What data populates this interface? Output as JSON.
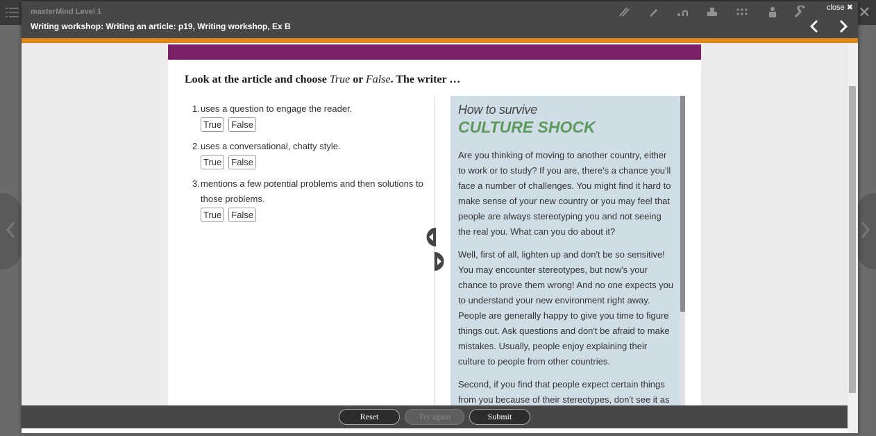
{
  "app": {
    "title": "masterMind Level 1"
  },
  "header": {
    "page_title": "Writing workshop: Writing an article: p19, Writing workshop, Ex B",
    "close_label": "close ✖"
  },
  "exercise": {
    "instruction_pre": "Look at the article and choose ",
    "instruction_true": "True",
    "instruction_mid": " or ",
    "instruction_false": "False",
    "instruction_post": ". The writer …",
    "questions": [
      {
        "number": "1.",
        "text": "uses a question to engage the reader.",
        "options": [
          "True",
          "False"
        ]
      },
      {
        "number": "2.",
        "text": "uses a conversational, chatty style.",
        "options": [
          "True",
          "False"
        ]
      },
      {
        "number": "3.",
        "text": "mentions a few potential problems and then solutions to those problems.",
        "options": [
          "True",
          "False"
        ]
      }
    ]
  },
  "article": {
    "subtitle": "How to survive",
    "title": "CULTURE SHOCK",
    "paragraphs": [
      "Are you thinking of moving to another country, either to work or to study? If you are, there's a chance you'll face a number of challenges. You might find it hard to make sense of your new country or you may feel that people are always stereotyping you and not seeing the real you. What can you do about it?",
      "Well, first of all, lighten up and don't be so sensitive! You may encounter stereotypes, but now's your chance to prove them wrong! And no one expects you to understand your new environment right away. People are generally happy to give you time to figure things out. Ask questions and don't be afraid to make mistakes. Usually, people enjoy explaining their culture to people from other countries.",
      "Second, if you find that people expect certain things from you because of their stereotypes, don't see it as"
    ]
  },
  "footer": {
    "reset": "Reset",
    "try_again": "Try again",
    "submit": "Submit"
  },
  "colors": {
    "accent": "#e0861f",
    "band": "#7e1f6a",
    "article_bg": "#cfdde6",
    "title_green": "#5e9a5e"
  }
}
